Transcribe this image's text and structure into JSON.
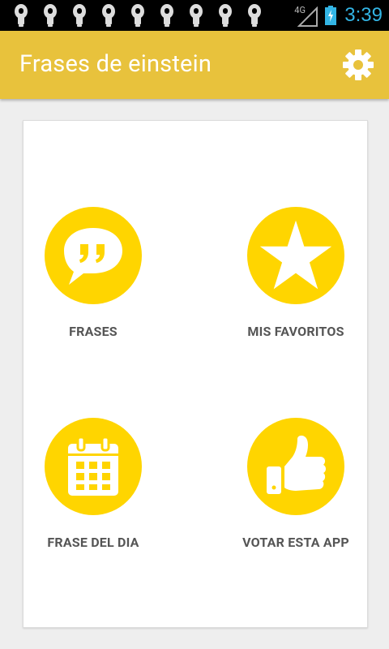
{
  "status_bar": {
    "network": "4G",
    "time": "3:39",
    "notification_icons": [
      "lightbulb-icon",
      "lightbulb-icon",
      "lightbulb-icon",
      "lightbulb-icon",
      "lightbulb-icon",
      "lightbulb-icon",
      "lightbulb-icon",
      "lightbulb-icon",
      "lightbulb-icon"
    ]
  },
  "action_bar": {
    "title": "Frases de einstein",
    "settings_icon": "gear-icon"
  },
  "menu": {
    "frases": {
      "label": "FRASES",
      "icon": "quote-bubble-icon"
    },
    "favoritos": {
      "label": "MIS FAVORITOS",
      "icon": "star-icon"
    },
    "frase_dia": {
      "label": "FRASE DEL DIA",
      "icon": "calendar-icon"
    },
    "votar": {
      "label": "VOTAR ESTA APP",
      "icon": "thumbs-up-icon"
    }
  },
  "colors": {
    "accent": "#e8c23c",
    "icon_circle": "#ffd500",
    "clock": "#33b5e5"
  }
}
